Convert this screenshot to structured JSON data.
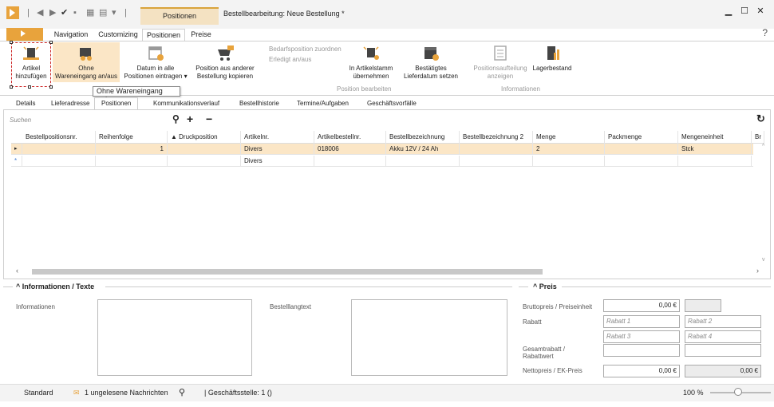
{
  "window": {
    "context_tab": "Positionen",
    "title": "Bestellbearbeitung: Neue Bestellung *",
    "help": "?"
  },
  "ribbon_tabs": [
    "Navigation",
    "Customizing",
    "Positionen",
    "Preise"
  ],
  "ribbon": {
    "artikel_hinzufuegen": [
      "Artikel",
      "hinzufügen"
    ],
    "ohne_wareneingang": [
      "Ohne",
      "Wareneingang an/aus"
    ],
    "datum_alle": [
      "Datum in alle",
      "Positionen eintragen ▾"
    ],
    "position_kopieren": [
      "Position aus anderer",
      "Bestellung kopieren"
    ],
    "bedarfsposition": "Bedarfsposition zuordnen",
    "erledigt": "Erledigt an/aus",
    "artikelstamm": [
      "In Artikelstamm",
      "übernehmen"
    ],
    "lieferdatum": [
      "Bestätigtes",
      "Lieferdatum setzen"
    ],
    "positionsaufteilung": [
      "Positionsaufteilung",
      "anzeigen"
    ],
    "lagerbestand": "Lagerbestand",
    "group_position": "Position bearbeiten",
    "group_info": "Informationen",
    "tooltip": "Ohne Wareneingang an/aus"
  },
  "page_tabs": [
    "Details",
    "Lieferadresse",
    "Positionen",
    "Kommunikationsverlauf",
    "Bestellhistorie",
    "Termine/Aufgaben",
    "Geschäftsvorfälle"
  ],
  "grid": {
    "search_placeholder": "Suchen",
    "columns": [
      "Bestellpositionsnr.",
      "Reihenfolge",
      "▲  Druckposition",
      "Artikelnr.",
      "Artikelbestellnr.",
      "Bestellbezeichnung",
      "Bestellbezeichnung 2",
      "Menge",
      "Packmenge",
      "Mengeneinheit",
      "Br"
    ],
    "rows": [
      [
        "",
        "1",
        "",
        "Divers",
        "018006",
        "Akku 12V / 24 Ah",
        "",
        "2",
        "",
        "Stck",
        ""
      ],
      [
        "",
        "",
        "",
        "Divers",
        "",
        "",
        "",
        "",
        "",
        "",
        ""
      ]
    ]
  },
  "info": {
    "heading": "Informationen / Texte",
    "informationen": "Informationen",
    "bestelllangtext": "Bestelllangtext"
  },
  "preis": {
    "heading": "Preis",
    "brutto_label": "Bruttopreis / Preiseinheit",
    "brutto_value": "0,00 €",
    "rabatt_label": "Rabatt",
    "rabatt1": "Rabatt 1",
    "rabatt2": "Rabatt 2",
    "rabatt3": "Rabatt 3",
    "rabatt4": "Rabatt 4",
    "gesamt_label1": "Gesamtrabatt /",
    "gesamt_label2": "Rabattwert",
    "netto_label": "Nettopreis / EK-Preis",
    "netto_value": "0,00 €",
    "netto_value2": "0,00 €"
  },
  "status": {
    "mode": "Standard",
    "messages": "1 ungelesene Nachrichten",
    "branch": "| Geschäftsstelle: 1 ()",
    "zoom": "100 %"
  }
}
